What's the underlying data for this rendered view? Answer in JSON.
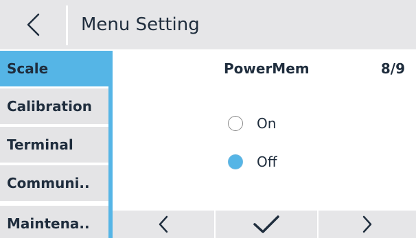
{
  "header": {
    "title": "Menu Setting",
    "back_icon": "chevron-left-icon"
  },
  "sidebar": {
    "items": [
      {
        "label": "Scale",
        "active": true
      },
      {
        "label": "Calibration",
        "active": false
      },
      {
        "label": "Terminal",
        "active": false
      },
      {
        "label": "Communi..",
        "active": false
      },
      {
        "label": "Maintena..",
        "active": false
      }
    ]
  },
  "main": {
    "parameter_name": "PowerMem",
    "page_indicator": "8/9",
    "options": [
      {
        "label": "On",
        "selected": false
      },
      {
        "label": "Off",
        "selected": true
      }
    ]
  },
  "bottom_nav": {
    "prev_icon": "chevron-left-icon",
    "confirm_icon": "checkmark-icon",
    "next_icon": "chevron-right-icon"
  },
  "colors": {
    "accent": "#55b5e6",
    "header_bg": "#e6e6e8",
    "sidebar_bg": "#e4e4e6",
    "text": "#1f2d3d"
  }
}
